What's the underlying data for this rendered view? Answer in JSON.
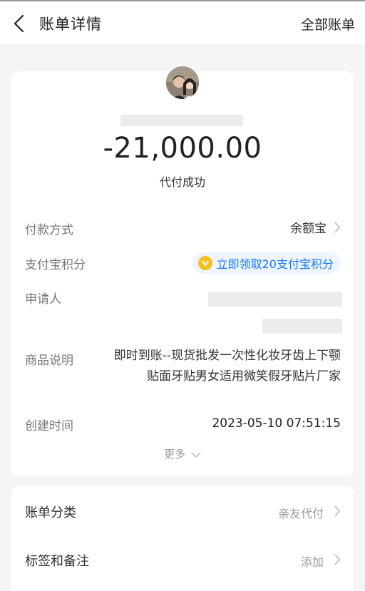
{
  "header": {
    "back_icon": "chevron-left-icon",
    "title": "账单详情",
    "all_bills": "全部账单"
  },
  "summary": {
    "amount": "-21,000.00",
    "status": "代付成功"
  },
  "details": {
    "payment_method_label": "付款方式",
    "payment_method_value": "余额宝",
    "points_label": "支付宝积分",
    "points_action": "立即领取20支付宝积分",
    "applicant_label": "申请人",
    "product_label": "商品说明",
    "product_line1": "即时到账--现货批发一次性化妆牙齿上下颚",
    "product_line2": "贴面牙贴男女适用微笑假牙贴片厂家",
    "created_label": "创建时间",
    "created_value": "2023-05-10 07:51:15",
    "more": "更多"
  },
  "extra": {
    "category_label": "账单分类",
    "category_value": "亲友代付",
    "tags_label": "标签和备注",
    "tags_value": "添加"
  },
  "colors": {
    "accent": "#1677ff",
    "coin": "#f4c21f",
    "background": "#f5f5f5"
  }
}
